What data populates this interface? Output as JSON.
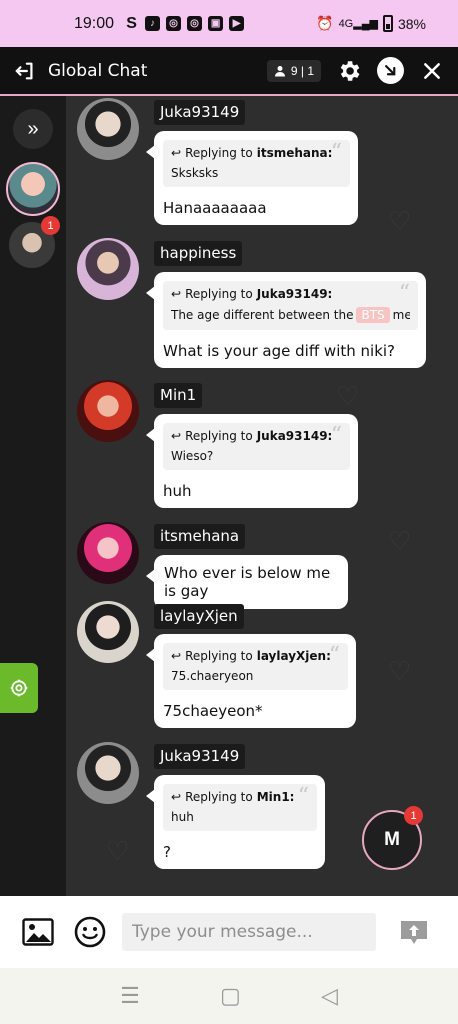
{
  "status_bar": {
    "time": "19:00",
    "apps": [
      "S",
      "tiktok",
      "instagram",
      "instagram",
      "gallery",
      "youtube"
    ],
    "network": "4G",
    "battery": "38%"
  },
  "header": {
    "title": "Global Chat",
    "user_count": "9 | 1",
    "icons": [
      "logout-icon",
      "user-icon",
      "gear-icon",
      "minimize-icon",
      "close-icon"
    ]
  },
  "sidebar": {
    "toggle": "»",
    "unread_badge": "1"
  },
  "messages": [
    {
      "user": "Juka93149",
      "reply_label": "Replying to",
      "reply_to": "itsmehana:",
      "reply_text": "Sksksks",
      "text": "Hanaaaaaaaa"
    },
    {
      "user": "happiness",
      "reply_label": "Replying to",
      "reply_to": "Juka93149:",
      "reply_text_before": "The age different between the",
      "reply_highlight": "BTS",
      "reply_text_after": "members a",
      "text": "What is your age diff with niki?"
    },
    {
      "user": "Min1",
      "reply_label": "Replying to",
      "reply_to": "Juka93149:",
      "reply_text": "Wieso?",
      "text": "huh"
    },
    {
      "user": "itsmehana",
      "text": "Who ever is below me is gay"
    },
    {
      "user": "laylayXjen",
      "reply_label": "Replying to",
      "reply_to": "laylayXjen:",
      "reply_text": "75.chaeryeon",
      "text": "75chaeyeon*"
    },
    {
      "user": "Juka93149",
      "reply_label": "Replying to",
      "reply_to": "Min1:",
      "reply_text": "huh",
      "text": "?"
    }
  ],
  "fab": {
    "label": "M",
    "badge": "1"
  },
  "composer": {
    "placeholder": "Type your message..."
  },
  "colors": {
    "accent_pink": "#e8a6c4",
    "status_bar": "#f4c8f0",
    "badge_red": "#e53935",
    "settings_green": "#6aba2c"
  }
}
